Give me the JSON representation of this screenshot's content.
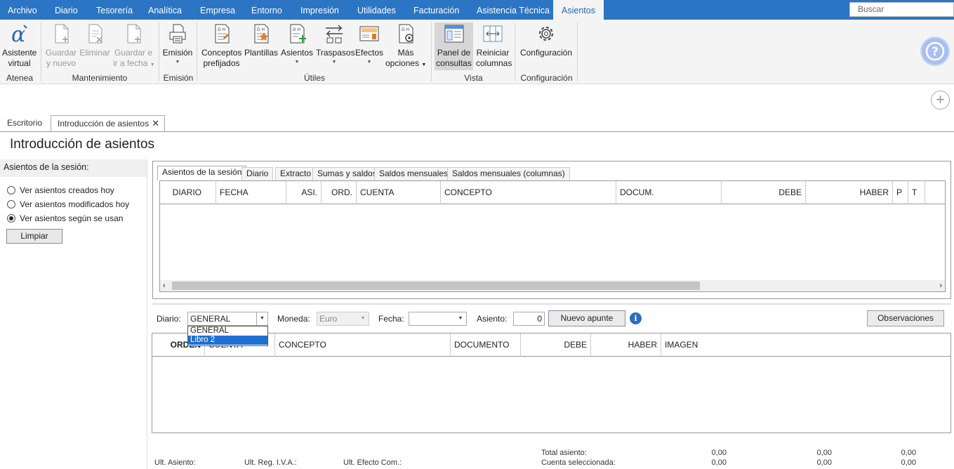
{
  "menu": {
    "tabs": [
      "Archivo",
      "Diario",
      "Tesorería",
      "Analítica",
      "Empresa",
      "Entorno",
      "Impresión",
      "Utilidades",
      "Facturación",
      "Asistencia Técnica",
      "Asientos"
    ],
    "search_placeholder": "Buscar"
  },
  "ribbon": {
    "buttons": {
      "asistente": [
        "Asistente",
        "virtual"
      ],
      "guardar_nuevo": [
        "Guardar",
        "y nuevo"
      ],
      "eliminar": [
        "Eliminar"
      ],
      "guardar_fecha": [
        "Guardar e",
        "ir a fecha"
      ],
      "emision": [
        "Emisión"
      ],
      "conceptos": [
        "Conceptos",
        "prefijados"
      ],
      "plantillas": [
        "Plantillas"
      ],
      "asientos": [
        "Asientos"
      ],
      "traspasos": [
        "Traspasos"
      ],
      "efectos": [
        "Efectos"
      ],
      "mas_opciones": [
        "Más",
        "opciones"
      ],
      "panel": [
        "Panel de",
        "consultas"
      ],
      "reiniciar": [
        "Reiniciar",
        "columnas"
      ],
      "configuracion": [
        "Configuración"
      ]
    },
    "groups": {
      "atenea": "Atenea",
      "mantenimiento": "Mantenimiento",
      "emision": "Emisión",
      "utiles": "Útiles",
      "vista": "Vista",
      "configuracion": "Configuración"
    }
  },
  "doc_tabs": [
    "Escritorio",
    "Introducción de asientos"
  ],
  "page_title": "Introducción de asientos",
  "left_panel": {
    "header": "Asientos de la sesión:",
    "options": [
      "Ver asientos creados hoy",
      "Ver asientos modificados hoy",
      "Ver asientos según se usan"
    ],
    "selected_index": 2,
    "clear_button": "Limpiar"
  },
  "inner_tabs": [
    "Asientos de la sesión",
    "Diario",
    "Extracto",
    "Sumas y saldos",
    "Saldos mensuales",
    "Saldos mensuales (columnas)"
  ],
  "upper_grid": {
    "columns": [
      "DIARIO",
      "FECHA",
      "ASI.",
      "ORD.",
      "CUENTA",
      "CONCEPTO",
      "DOCUM.",
      "DEBE",
      "HABER",
      "P",
      "T"
    ]
  },
  "form": {
    "diario_label": "Diario:",
    "diario_value": "GENERAL",
    "moneda_label": "Moneda:",
    "moneda_value": "Euro",
    "fecha_label": "Fecha:",
    "fecha_value": "",
    "asiento_label": "Asiento:",
    "asiento_value": "0",
    "nuevo_apunte": "Nuevo apunte",
    "observaciones": "Observaciones",
    "diario_options": [
      "GENERAL",
      "Libro 2"
    ],
    "diario_highlighted": 1
  },
  "lower_grid": {
    "columns": [
      "ORDEN",
      "CUENTA",
      "CONCEPTO",
      "DOCUMENTO",
      "DEBE",
      "HABER",
      "IMAGEN"
    ]
  },
  "footer": {
    "ult_asiento": "Ult. Asiento:",
    "ult_reg_iva": "Ult. Reg. I.V.A.:",
    "ult_efecto": "Ult. Efecto Com.:",
    "total_asiento": "Total asiento:",
    "cuenta_seleccionada": "Cuenta seleccionada:",
    "totals_row1": [
      "0,00",
      "0,00",
      "0,00"
    ],
    "totals_row2": [
      "0,00",
      "0,00",
      "0,00"
    ]
  },
  "colors": {
    "menubar": "#2b75c4",
    "ribbon_bg": "#f4f4f4",
    "help_button": "#a8c0ee",
    "dropdown_highlight": "#1f6fd1"
  }
}
